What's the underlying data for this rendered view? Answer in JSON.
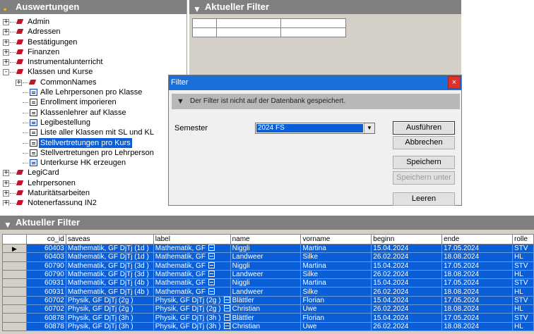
{
  "left_panel": {
    "title": "Auswertungen",
    "tree": [
      {
        "level": 0,
        "exp": "+",
        "icon": "book",
        "label": "Admin"
      },
      {
        "level": 0,
        "exp": "+",
        "icon": "book",
        "label": "Adressen"
      },
      {
        "level": 0,
        "exp": "+",
        "icon": "book",
        "label": "Bestätigungen"
      },
      {
        "level": 0,
        "exp": "+",
        "icon": "book",
        "label": "Finanzen"
      },
      {
        "level": 0,
        "exp": "+",
        "icon": "book",
        "label": "Instrumentalunterricht"
      },
      {
        "level": 0,
        "exp": "-",
        "icon": "book",
        "label": "Klassen und Kurse"
      },
      {
        "level": 1,
        "exp": "+",
        "icon": "book",
        "label": "CommonNames"
      },
      {
        "level": 1,
        "exp": "",
        "icon": "doc-blue",
        "label": "Alle Lehrpersonen pro Klasse"
      },
      {
        "level": 1,
        "exp": "",
        "icon": "doc",
        "label": "Enrollment imporieren"
      },
      {
        "level": 1,
        "exp": "",
        "icon": "doc",
        "label": "Klassenlehrer auf Klasse"
      },
      {
        "level": 1,
        "exp": "",
        "icon": "doc-blue",
        "label": "Legibestellung"
      },
      {
        "level": 1,
        "exp": "",
        "icon": "doc",
        "label": "Liste aller Klassen mit SL und KL"
      },
      {
        "level": 1,
        "exp": "",
        "icon": "doc",
        "label": "Stellvertretungen pro Kurs",
        "selected": true
      },
      {
        "level": 1,
        "exp": "",
        "icon": "doc",
        "label": "Stellvertretungen pro Lehrperson"
      },
      {
        "level": 1,
        "exp": "",
        "icon": "doc-blue",
        "label": "Unterkurse HK erzeugen"
      },
      {
        "level": 0,
        "exp": "+",
        "icon": "book",
        "label": "LegiCard"
      },
      {
        "level": 0,
        "exp": "+",
        "icon": "book",
        "label": "Lehrpersonen"
      },
      {
        "level": 0,
        "exp": "+",
        "icon": "book",
        "label": "Maturitätsarbeiten"
      },
      {
        "level": 0,
        "exp": "+",
        "icon": "book",
        "label": "Notenerfassung IN2"
      }
    ]
  },
  "right_panel": {
    "title": "Aktueller Filter"
  },
  "dialog": {
    "title": "Filter",
    "close": "×",
    "info": "Der Filter ist nicht auf der Datenbank gespeichert.",
    "semester_label": "Semester",
    "semester_value": "2024 FS",
    "buttons": {
      "run": "Ausführen",
      "cancel": "Abbrechen",
      "save": "Speichern",
      "save_as": "Speichern unter",
      "clear": "Leeren"
    }
  },
  "bottom_panel": {
    "title": "Aktueller Filter",
    "columns": [
      "co_id",
      "saveas",
      "label",
      "name",
      "vorname",
      "beginn",
      "ende",
      "rolle"
    ],
    "rows": [
      [
        "60403",
        "Mathematik, GF DjTj (1d )",
        "Mathematik, GF",
        "Niggli",
        "Martina",
        "15.04.2024",
        "17.05.2024",
        "STV"
      ],
      [
        "60403",
        "Mathematik, GF DjTj (1d )",
        "Mathematik, GF",
        "Landweer",
        "Silke",
        "26.02.2024",
        "18.08.2024",
        "HL"
      ],
      [
        "60790",
        "Mathematik, GF DjTj (3d )",
        "Mathematik, GF",
        "Niggli",
        "Martina",
        "15.04.2024",
        "17.05.2024",
        "STV"
      ],
      [
        "60790",
        "Mathematik, GF DjTj (3d )",
        "Mathematik, GF",
        "Landweer",
        "Silke",
        "26.02.2024",
        "18.08.2024",
        "HL"
      ],
      [
        "60931",
        "Mathematik, GF DjTj (4b )",
        "Mathematik, GF",
        "Niggli",
        "Martina",
        "15.04.2024",
        "17.05.2024",
        "STV"
      ],
      [
        "60931",
        "Mathematik, GF DjTj (4b )",
        "Mathematik, GF",
        "Landweer",
        "Silke",
        "26.02.2024",
        "18.08.2024",
        "HL"
      ],
      [
        "60702",
        "Physik, GF DjTj (2g )",
        "Physik, GF DjTj (2g )",
        "Blättler",
        "Florian",
        "15.04.2024",
        "17.05.2024",
        "STV"
      ],
      [
        "60702",
        "Physik, GF DjTj (2g )",
        "Physik, GF DjTj (2g )",
        "Christian",
        "Uwe",
        "26.02.2024",
        "18.08.2024",
        "HL"
      ],
      [
        "60878",
        "Physik, GF DjTj (3h )",
        "Physik, GF DjTj (3h )",
        "Blättler",
        "Florian",
        "15.04.2024",
        "17.05.2024",
        "STV"
      ],
      [
        "60878",
        "Physik, GF DjTj (3h )",
        "Physik, GF DjTj (3h )",
        "Christian",
        "Uwe",
        "26.02.2024",
        "18.08.2024",
        "HL"
      ]
    ],
    "current_row_marker": "▶"
  },
  "icons": {
    "header_left": "folder-icon",
    "filter": "funnel-icon"
  }
}
